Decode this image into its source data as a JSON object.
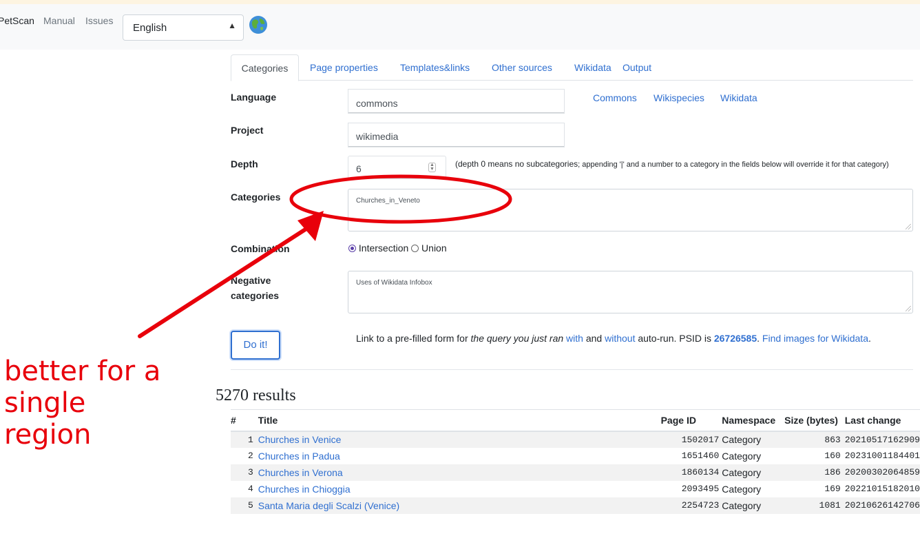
{
  "navbar": {
    "brand": "PetScan",
    "links": [
      "Manual",
      "Issues"
    ],
    "language_select": "English",
    "globe_icon": "globe-icon"
  },
  "tabs": [
    {
      "label": "Categories",
      "active": true
    },
    {
      "label": "Page properties"
    },
    {
      "label": "Templates&links"
    },
    {
      "label": "Other sources"
    },
    {
      "label": "Wikidata"
    },
    {
      "label": "Output"
    }
  ],
  "form": {
    "language": {
      "label": "Language",
      "value": "commons"
    },
    "shortcuts": [
      "Commons",
      "Wikispecies",
      "Wikidata"
    ],
    "project": {
      "label": "Project",
      "value": "wikimedia"
    },
    "depth": {
      "label": "Depth",
      "value": "6",
      "hint_main": "(depth 0 means no subcategories",
      "hint_rest": "; appending '|' and a number to a category in the fields below will override it for that category)"
    },
    "categories": {
      "label": "Categories",
      "value": "Churches_in_Veneto"
    },
    "combination": {
      "label": "Combination",
      "intersection": "Intersection",
      "union": "Union"
    },
    "negative": {
      "label_line1": "Negative",
      "label_line2": "categories",
      "value": "Uses of Wikidata Infobox"
    }
  },
  "action": {
    "button": "Do it!",
    "prefix": "Link to a pre-filled form for ",
    "query_italic": "the query you just ran",
    "with_link": "with",
    "and_text": " and ",
    "without_link": "without",
    "autorun_text": " auto-run. PSID is ",
    "psid": "26726585",
    "dot": ". ",
    "find_images": "Find images for Wikidata",
    "end_dot": "."
  },
  "results": {
    "title": "5270 results",
    "columns": [
      "#",
      "Title",
      "Page ID",
      "Namespace",
      "Size (bytes)",
      "Last change"
    ],
    "rows": [
      {
        "n": "1",
        "title": "Churches in Venice",
        "page_id": "1502017",
        "namespace": "Category",
        "size": "863",
        "last_change": "20210517162909"
      },
      {
        "n": "2",
        "title": "Churches in Padua",
        "page_id": "1651460",
        "namespace": "Category",
        "size": "160",
        "last_change": "20231001184401"
      },
      {
        "n": "3",
        "title": "Churches in Verona",
        "page_id": "1860134",
        "namespace": "Category",
        "size": "186",
        "last_change": "20200302064859"
      },
      {
        "n": "4",
        "title": "Churches in Chioggia",
        "page_id": "2093495",
        "namespace": "Category",
        "size": "169",
        "last_change": "20221015182010"
      },
      {
        "n": "5",
        "title": "Santa Maria degli Scalzi (Venice)",
        "page_id": "2254723",
        "namespace": "Category",
        "size": "1081",
        "last_change": "20210626142706"
      }
    ]
  },
  "annotation": {
    "text_lines": [
      "better for a",
      "single",
      "region"
    ],
    "color": "#e8000b"
  }
}
